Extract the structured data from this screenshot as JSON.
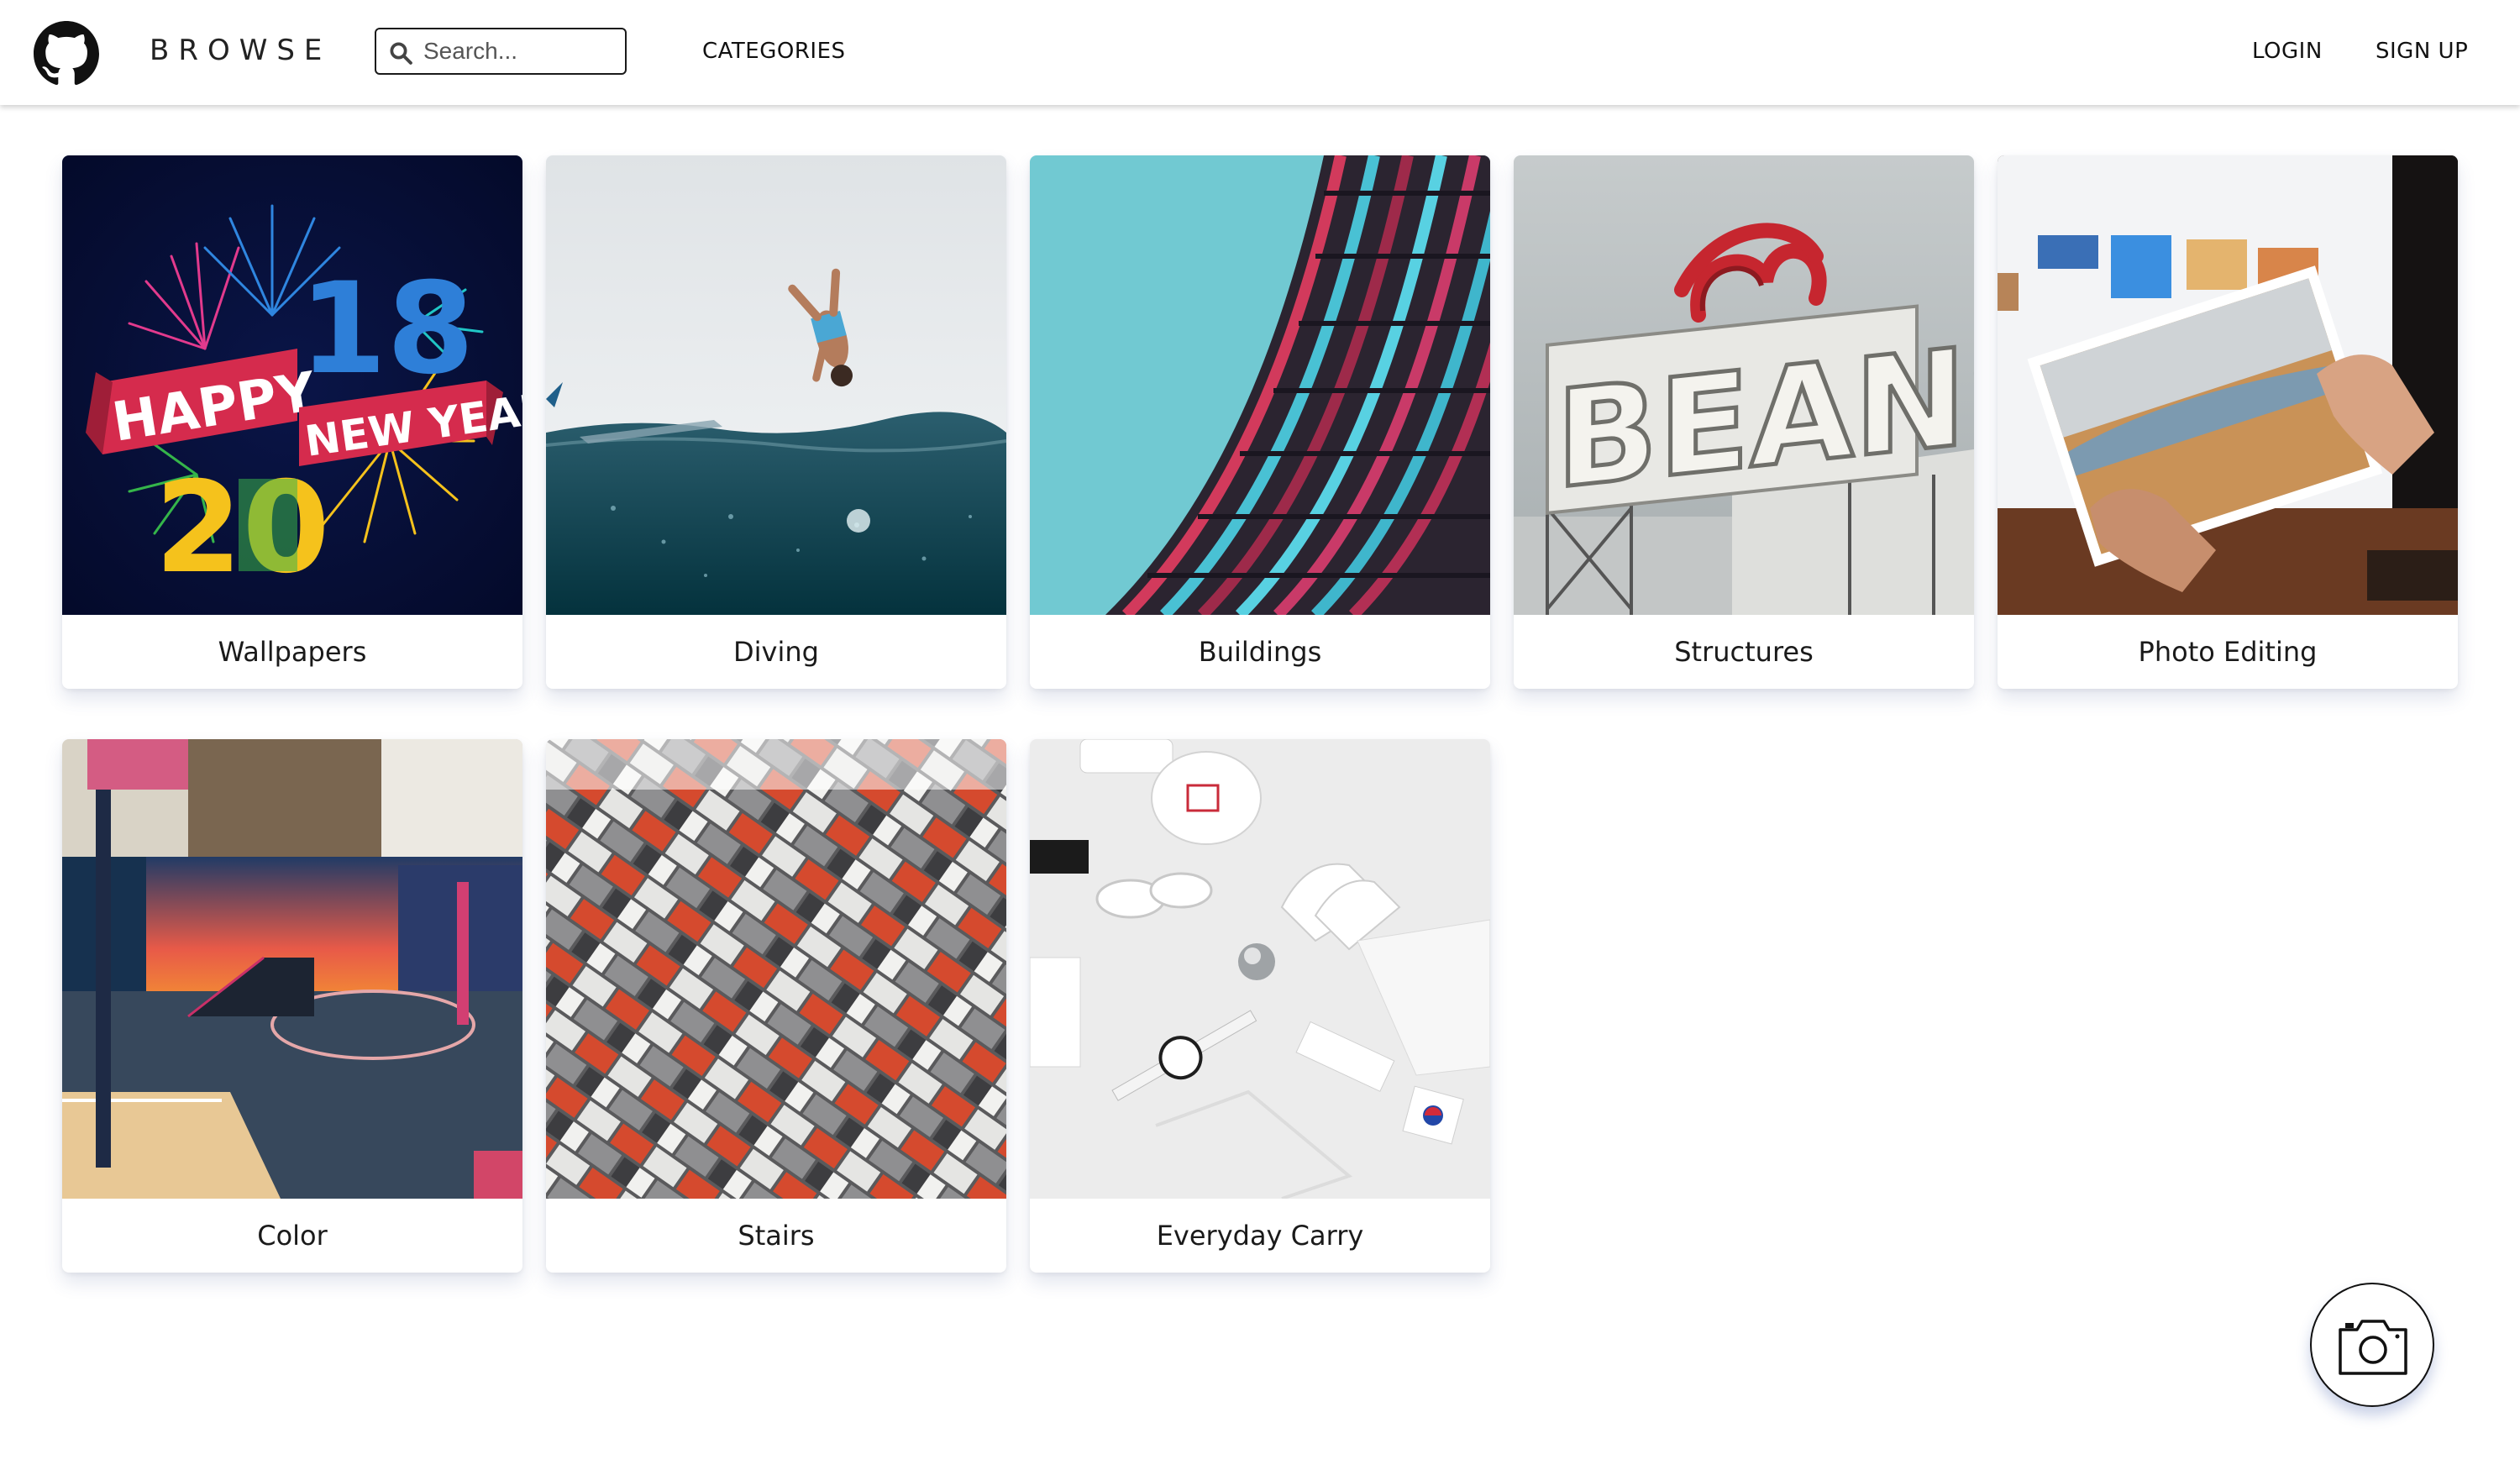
{
  "header": {
    "logo_icon": "github-octocat-icon",
    "brand": "BROWSE",
    "search": {
      "placeholder": "Search...",
      "value": ""
    },
    "nav": {
      "categories": "CATEGORIES",
      "login": "LOGIN",
      "signup": "SIGN UP"
    }
  },
  "categories": [
    {
      "label": "Wallpapers",
      "image": "happy-new-year-2018-fireworks"
    },
    {
      "label": "Diving",
      "image": "diver-jumping-over-sea"
    },
    {
      "label": "Buildings",
      "image": "curved-building-facade-sky"
    },
    {
      "label": "Structures",
      "image": "beans-rooftop-sign"
    },
    {
      "label": "Photo Editing",
      "image": "hands-holding-photo-print"
    },
    {
      "label": "Color",
      "image": "colorful-basketball-court"
    },
    {
      "label": "Stairs",
      "image": "gray-red-white-tiled-steps"
    },
    {
      "label": "Everyday Carry",
      "image": "white-items-flat-lay"
    }
  ],
  "thumbnail_text": {
    "happy": "HAPPY",
    "new_year": "NEW YEAR",
    "year_top": "18",
    "year_bottom": "20",
    "beans": "BEANS"
  },
  "fab": {
    "icon": "camera-icon"
  },
  "colors": {
    "text": "#1a1a1a",
    "card_shadow": "#3c508c",
    "fab_shadow": "#3c5aaa"
  }
}
